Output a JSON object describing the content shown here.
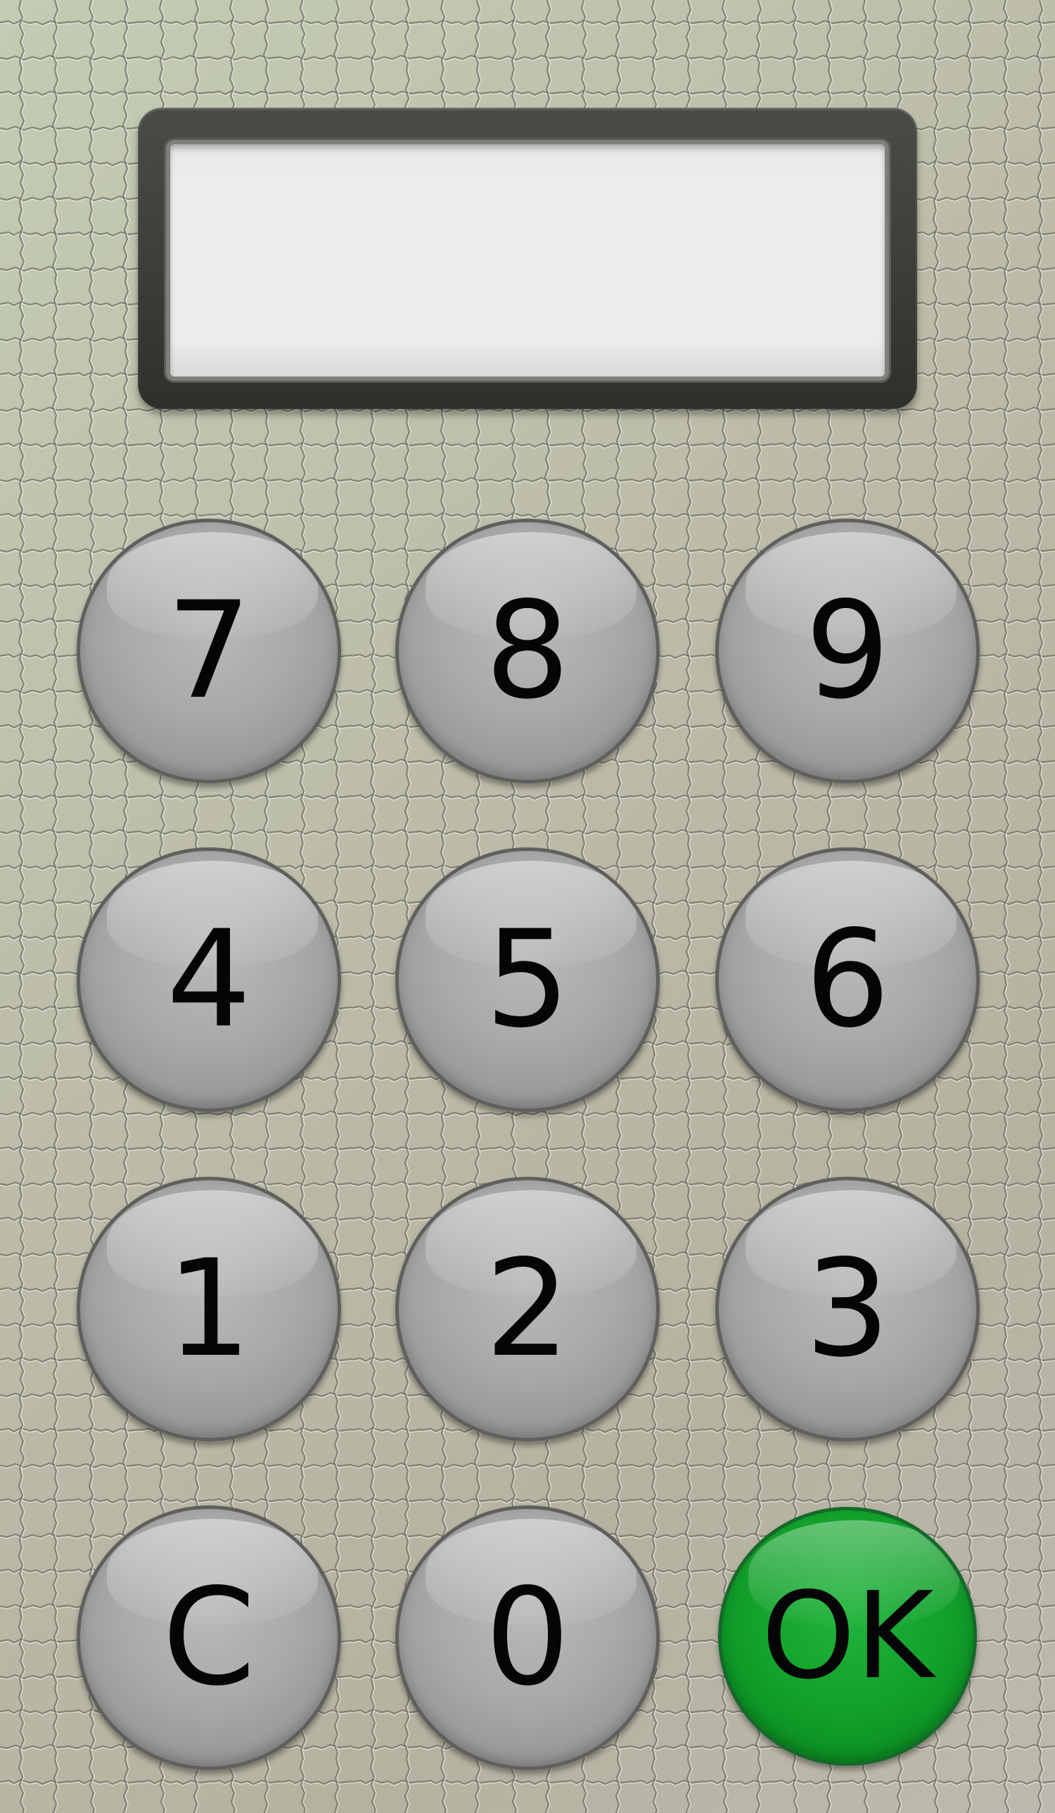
{
  "display": {
    "value": ""
  },
  "keypad": {
    "keys": [
      {
        "label": "7",
        "name": "key-7"
      },
      {
        "label": "8",
        "name": "key-8"
      },
      {
        "label": "9",
        "name": "key-9"
      },
      {
        "label": "4",
        "name": "key-4"
      },
      {
        "label": "5",
        "name": "key-5"
      },
      {
        "label": "6",
        "name": "key-6"
      },
      {
        "label": "1",
        "name": "key-1"
      },
      {
        "label": "2",
        "name": "key-2"
      },
      {
        "label": "3",
        "name": "key-3"
      },
      {
        "label": "C",
        "name": "clear-button"
      },
      {
        "label": "0",
        "name": "key-0"
      },
      {
        "label": "OK",
        "name": "ok-button"
      }
    ]
  },
  "colors": {
    "key_gray": "#a9a9a9",
    "ok_green": "#12a12b",
    "display_frame": "#3a3c38",
    "display_screen": "#ececec"
  }
}
